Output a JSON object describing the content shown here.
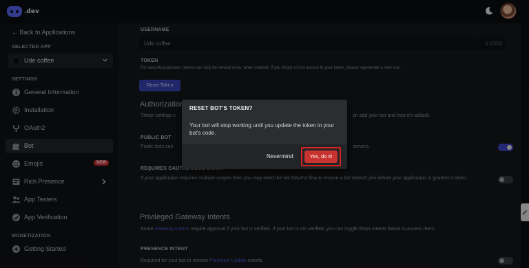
{
  "topbar": {
    "logo_text": ".dev",
    "avatar_alt": "User avatar"
  },
  "sidebar": {
    "back_link": "← Back to Applications",
    "selected_app_title": "SELECTED APP",
    "selected_app_name": "Ude coffee",
    "settings_title": "SETTINGS",
    "items": [
      {
        "label": "General Information",
        "icon": "info-icon"
      },
      {
        "label": "Installation",
        "icon": "gear-icon"
      },
      {
        "label": "OAuth2",
        "icon": "wrench-icon"
      },
      {
        "label": "Bot",
        "icon": "puzzle-icon",
        "active": true
      },
      {
        "label": "Emojis",
        "icon": "emoji-icon",
        "badge": "NEW"
      },
      {
        "label": "Rich Presence",
        "icon": "list-icon"
      },
      {
        "label": "App Testers",
        "icon": "users-icon"
      },
      {
        "label": "App Verification",
        "icon": "checkmark-icon"
      }
    ],
    "monetization_title": "MONETIZATION",
    "monetization_items": [
      {
        "label": "Getting Started",
        "icon": "spark-icon"
      }
    ]
  },
  "main": {
    "username_label": "USERNAME",
    "username_value": "Ude coffee",
    "username_discriminator": "# 8304",
    "token_label": "TOKEN",
    "token_help": "For security purposes, tokens can only be viewed once, when created. If you forgot or lost access to your token, please regenerate a new one.",
    "reset_token_button": "Reset Token",
    "authorization_heading": "Authorization",
    "authorization_text": "These settings c",
    "authorization_text_right": "an add your bot and how it's added).",
    "public_bot_label": "PUBLIC BOT",
    "public_bot_text": "Public bots can",
    "public_bot_text_right": "servers.",
    "requires_oauth_label": "REQUIRES OAUTH2 CODE GRANT",
    "requires_oauth_text": "If your application requires multiple scopes then you may need the full OAuth2 flow to ensure a bot doesn't join before your application is granted a token.",
    "privileged_heading": "Privileged Gateway Intents",
    "privileged_text_a": "Some ",
    "privileged_text_link": "Gateway Intents",
    "privileged_text_b": " require approval if your bot is verified. If your bot is not verified, you can toggle those intents below to access them.",
    "presence_label": "PRESENCE INTENT",
    "presence_text_a": "Required for your bot to receive ",
    "presence_text_link": "Presence Update",
    "presence_text_b": " events.",
    "toggles": {
      "public_bot": "on",
      "requires_oauth": "off",
      "presence": "off"
    }
  },
  "modal": {
    "title": "RESET BOT'S TOKEN?",
    "body": "Your bot will stop working until you update the token in your bot's code.",
    "cancel_label": "Nevermind",
    "confirm_label": "Yes, do it!"
  },
  "colors": {
    "accent": "#5865f2",
    "danger": "#c8322f",
    "highlight": "#d9231f"
  }
}
